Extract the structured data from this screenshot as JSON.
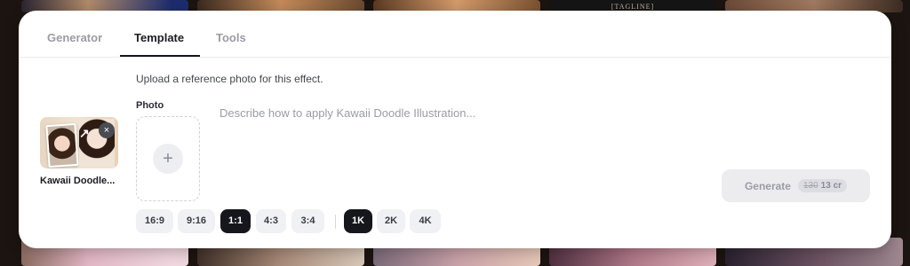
{
  "background": {
    "top_tagline": "[TAGLINE]"
  },
  "tabs": [
    {
      "label": "Generator"
    },
    {
      "label": "Template"
    },
    {
      "label": "Tools"
    }
  ],
  "active_tab": "Template",
  "hint": "Upload a reference photo for this effect.",
  "template": {
    "name": "Kawaii Doodle...",
    "remove_symbol": "×"
  },
  "photo": {
    "label": "Photo",
    "add_symbol": "+"
  },
  "prompt": {
    "placeholder": "Describe how to apply Kawaii Doodle Illustration...",
    "value": ""
  },
  "generate": {
    "label": "Generate",
    "old_cost": "130",
    "cost": "13 cr"
  },
  "aspect_ratios": [
    "16:9",
    "9:16",
    "1:1",
    "4:3",
    "3:4"
  ],
  "selected_aspect_ratio": "1:1",
  "resolutions": [
    "1K",
    "2K",
    "4K"
  ],
  "selected_resolution": "1K",
  "colors": {
    "accent": "#15171c",
    "muted_text": "#9a9ca6",
    "chip_bg": "#f0f1f4"
  }
}
